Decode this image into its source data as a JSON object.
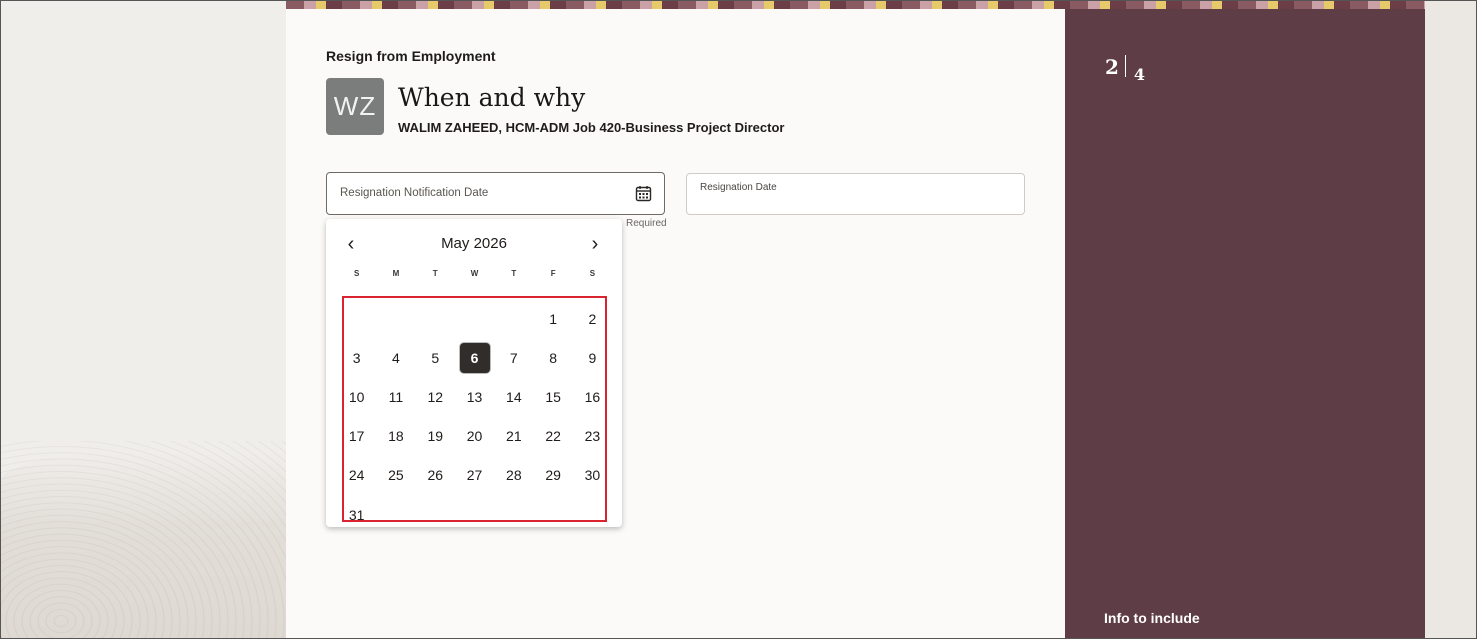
{
  "flow": {
    "title": "Resign from Employment",
    "page_title": "When and why",
    "person": "WALIM ZAHEED, HCM-ADM Job 420-Business Project Director",
    "avatar_initials": "WZ"
  },
  "fields": {
    "notification_date_label": "Resignation Notification Date",
    "resignation_date_label": "Resignation Date",
    "required_text": "Required",
    "calendar_icon": "calendar-icon"
  },
  "datepicker": {
    "month_label": "May 2026",
    "prev_glyph": "‹",
    "next_glyph": "›",
    "weekdays": [
      "S",
      "M",
      "T",
      "W",
      "T",
      "F",
      "S"
    ],
    "leading_blanks": 5,
    "days_in_month": 31,
    "selected_day": 6,
    "highlight_color": "#d9232e"
  },
  "side_panel": {
    "current_step": "2",
    "total_steps": "4",
    "info_heading": "Info to include",
    "background_color": "#5f3d46"
  }
}
